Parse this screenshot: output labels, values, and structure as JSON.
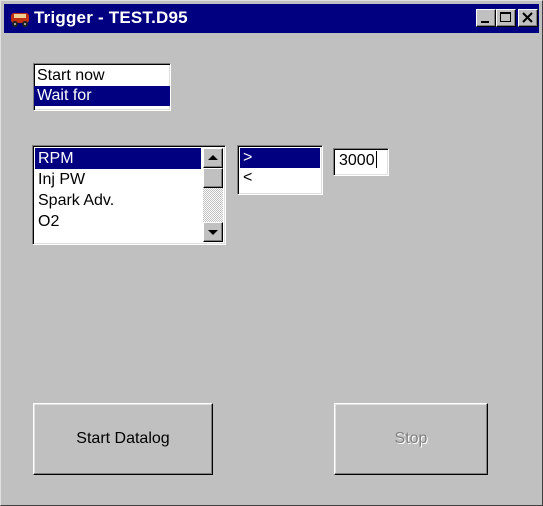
{
  "window": {
    "title": "Trigger - TEST.D95",
    "icon": "car-app-icon",
    "controls": [
      "minimize-icon",
      "maximize-icon",
      "close-icon"
    ]
  },
  "mode_list": {
    "items": [
      "Start now",
      "Wait for"
    ],
    "selected": "Wait for"
  },
  "parameter_list": {
    "items": [
      "RPM",
      "Inj PW",
      "Spark Adv.",
      "O2"
    ],
    "selected": "RPM"
  },
  "operator_list": {
    "items": [
      ">",
      "<"
    ],
    "selected": ">"
  },
  "threshold": {
    "value": "3000"
  },
  "buttons": {
    "start": "Start Datalog",
    "stop": "Stop"
  },
  "colors": {
    "titlebar": "#000080",
    "face": "#c0c0c0",
    "selection": "#000080"
  }
}
